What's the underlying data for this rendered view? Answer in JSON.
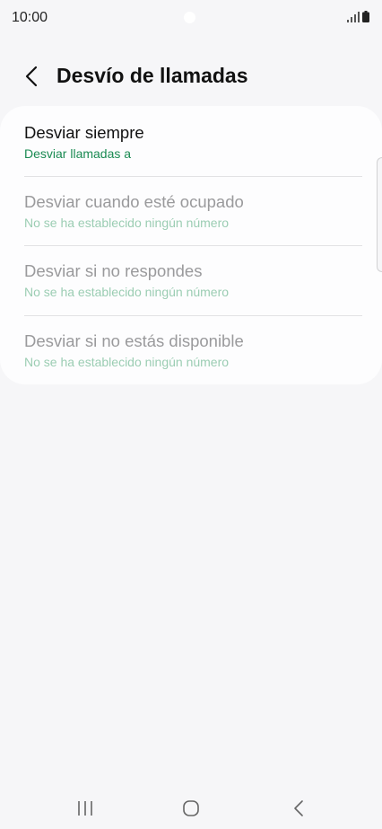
{
  "status_bar": {
    "time": "10:00"
  },
  "header": {
    "title": "Desvío de llamadas",
    "back_icon": "chevron-left-icon"
  },
  "forwarding": {
    "items": [
      {
        "title": "Desviar siempre",
        "subtitle": "Desviar llamadas a",
        "enabled": true
      },
      {
        "title": "Desviar cuando esté ocupado",
        "subtitle": "No se ha establecido ningún número",
        "enabled": false
      },
      {
        "title": "Desviar si no respondes",
        "subtitle": "No se ha establecido ningún número",
        "enabled": false
      },
      {
        "title": "Desviar si no estás disponible",
        "subtitle": "No se ha establecido ningún número",
        "enabled": false
      }
    ]
  },
  "nav_bar": {
    "icons": [
      "recent-apps-icon",
      "home-icon",
      "back-icon"
    ]
  },
  "colors": {
    "accent_green": "#1a8a52",
    "disabled_green": "#9bcdb3",
    "background": "#f6f6f8",
    "card": "#fdfdfe"
  }
}
